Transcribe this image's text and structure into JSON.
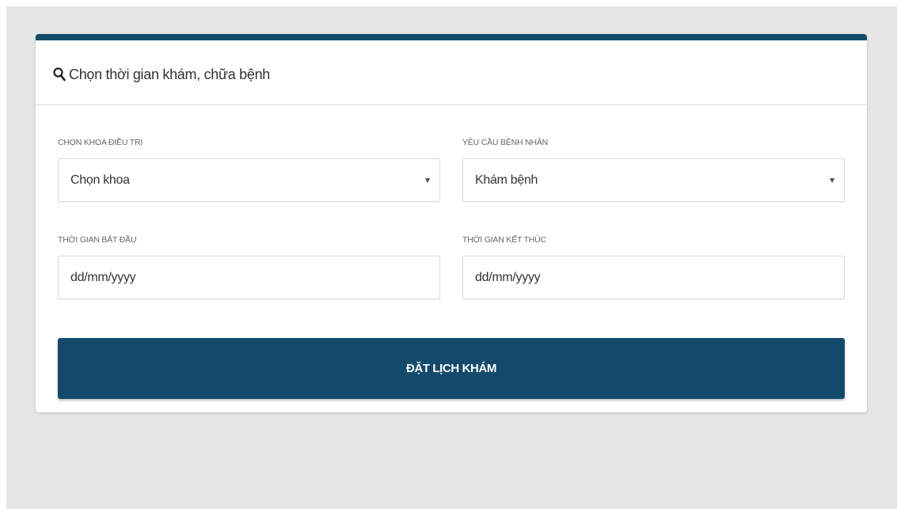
{
  "colors": {
    "accent": "#134a6b",
    "page_background": "#e6e6e6"
  },
  "header": {
    "icon": "search-icon",
    "title": "Chọn thời gian khám, chữa bệnh"
  },
  "form": {
    "department": {
      "label": "CHỌN KHOA ĐIỀU TRỊ",
      "value": "Chọn khoa",
      "icon": "caret-down-icon",
      "caret": "▼"
    },
    "request": {
      "label": "YÊU CẦU BỆNH NHÂN",
      "value": "Khám bệnh",
      "icon": "caret-down-icon",
      "caret": "▼"
    },
    "start_time": {
      "label": "THỜI GIAN BẮT ĐẦU",
      "placeholder": "dd/mm/yyyy"
    },
    "end_time": {
      "label": "THỜI GIAN KẾT THÚC",
      "placeholder": "dd/mm/yyyy"
    },
    "submit_label": "ĐẶT LỊCH KHÁM"
  }
}
